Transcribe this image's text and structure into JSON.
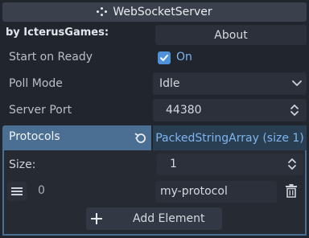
{
  "header": {
    "title": "WebSocketServer",
    "node_icon": "node-graph-icon"
  },
  "author": {
    "byline": "by IcterusGames:",
    "about_label": "About"
  },
  "properties": {
    "start_on_ready": {
      "label": "Start on Ready",
      "checked": true,
      "value_label": "On"
    },
    "poll_mode": {
      "label": "Poll Mode",
      "value": "Idle"
    },
    "server_port": {
      "label": "Server Port",
      "value": "44380"
    },
    "protocols": {
      "label": "Protocols",
      "type_label": "PackedStringArray (size 1)",
      "size_label": "Size:",
      "size_value": "1",
      "items": [
        {
          "index": "0",
          "value": "my-protocol"
        }
      ],
      "add_label": "Add Element"
    }
  },
  "colors": {
    "background": "#21252e",
    "accent": "#4f92dc",
    "highlight": "#4b6f92",
    "link": "#7eb5ef"
  }
}
